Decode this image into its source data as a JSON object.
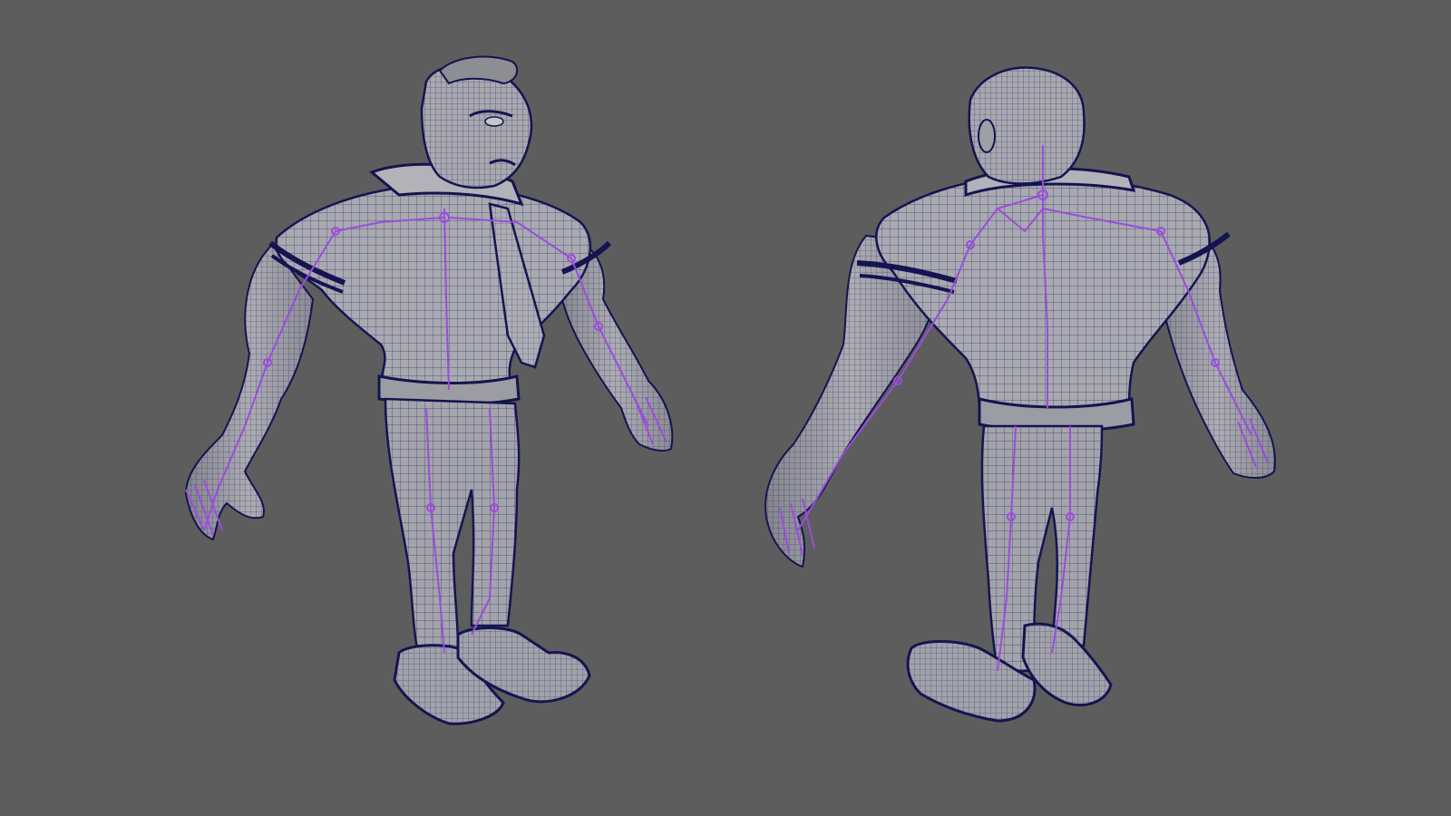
{
  "viewport": {
    "background": "#5d5d5d",
    "colors": {
      "mesh_fill": "#a7a7ad",
      "mesh_shade": "#8e8e96",
      "wire": "#1a1a66",
      "wire_edge": "#101050",
      "skeleton": "#9a4ddc"
    },
    "models": [
      {
        "view": "front-three-quarter"
      },
      {
        "view": "back-three-quarter"
      }
    ]
  }
}
